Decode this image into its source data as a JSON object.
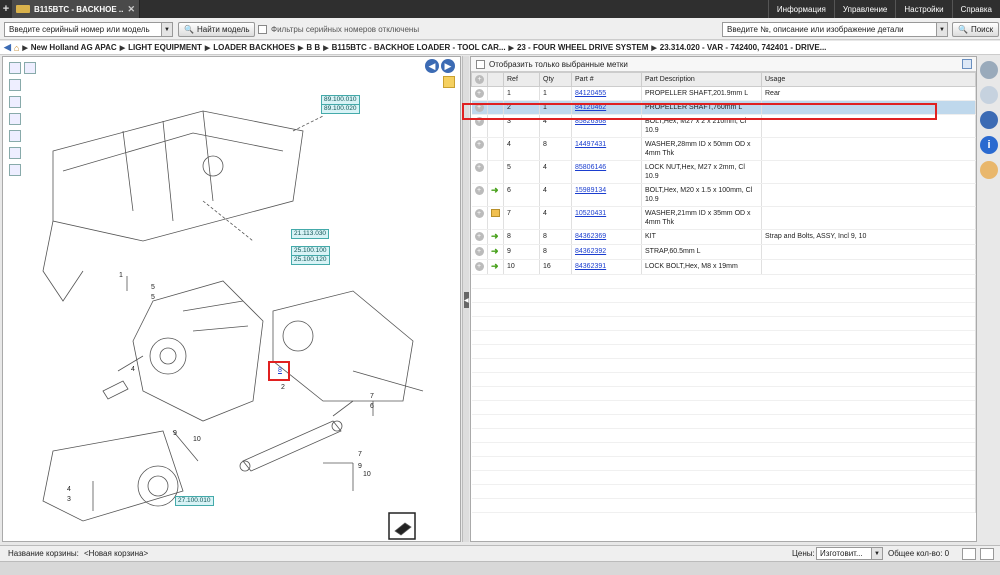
{
  "tab": {
    "title": "B115BTC - BACKHOE ..."
  },
  "top_menu": [
    "Информация",
    "Управление",
    "Настройки",
    "Справка"
  ],
  "search": {
    "serial_placeholder": "Введите серийный номер или модель",
    "find_model": "Найти модель",
    "filter_label": "Фильтры серийных номеров отключены",
    "query_placeholder": "Введите №, описание или изображение детали",
    "search_button": "Поиск"
  },
  "breadcrumb": [
    "New Holland AG APAC",
    "LIGHT EQUIPMENT",
    "LOADER BACKHOES",
    "B B",
    "B115BTC - BACKHOE LOADER - TOOL CAR...",
    "23 - FOUR WHEEL DRIVE SYSTEM",
    "23.314.020 - VAR - 742400, 742401 - DRIVE..."
  ],
  "diagram": {
    "callouts": [
      "89.100.010",
      "89.100.020",
      "21.113.030",
      "25.100.100",
      "25.100.120",
      "27.100.010"
    ],
    "labels": [
      "1",
      "2",
      "3",
      "4",
      "5",
      "6",
      "7",
      "8",
      "9",
      "10",
      "5",
      "4",
      "9",
      "10",
      "9",
      "10",
      "7"
    ]
  },
  "parts": {
    "show_selected_label": "Отобразить только выбранные метки",
    "headers": [
      "Ref",
      "Qty",
      "Part #",
      "Part Description",
      "Usage"
    ],
    "rows": [
      {
        "icon": "",
        "ref": "1",
        "qty": "1",
        "part": "84120455",
        "desc": "PROPELLER SHAFT,201.9mm L",
        "usage": "Rear"
      },
      {
        "icon": "",
        "ref": "2",
        "qty": "1",
        "part": "84120462",
        "desc": "PROPELLER SHAFT,760mm L",
        "usage": ""
      },
      {
        "icon": "",
        "ref": "3",
        "qty": "4",
        "part": "85826368",
        "desc": "BOLT,Hex, M27 x 2 x 210mm, Cl 10.9",
        "usage": ""
      },
      {
        "icon": "",
        "ref": "4",
        "qty": "8",
        "part": "14497431",
        "desc": "WASHER,28mm ID x 50mm OD x 4mm Thk",
        "usage": ""
      },
      {
        "icon": "",
        "ref": "5",
        "qty": "4",
        "part": "85806146",
        "desc": "LOCK NUT,Hex, M27 x 2mm, Cl 10.9",
        "usage": ""
      },
      {
        "icon": "arrow",
        "ref": "6",
        "qty": "4",
        "part": "15989134",
        "desc": "BOLT,Hex, M20 x 1.5 x 100mm, Cl 10.9",
        "usage": ""
      },
      {
        "icon": "box",
        "ref": "7",
        "qty": "4",
        "part": "10520431",
        "desc": "WASHER,21mm ID x 35mm OD x 4mm Thk",
        "usage": ""
      },
      {
        "icon": "arrow",
        "ref": "8",
        "qty": "8",
        "part": "84362369",
        "desc": "KIT",
        "usage": "Strap and Bolts, ASSY, Incl 9, 10"
      },
      {
        "icon": "arrow",
        "ref": "9",
        "qty": "8",
        "part": "84362392",
        "desc": "STRAP,60.5mm L",
        "usage": ""
      },
      {
        "icon": "arrow",
        "ref": "10",
        "qty": "16",
        "part": "84362391",
        "desc": "LOCK BOLT,Hex, M8 x 19mm",
        "usage": ""
      }
    ]
  },
  "bottom": {
    "basket_label": "Название корзины:",
    "basket_value": "<Новая корзина>",
    "price_label": "Цены:",
    "price_value": "Изготовит...",
    "total_label": "Общее кол-во: 0"
  },
  "colors": {
    "highlight": "#e02020",
    "selected_row": "#bfd8ec",
    "link": "#1b3ecf"
  }
}
